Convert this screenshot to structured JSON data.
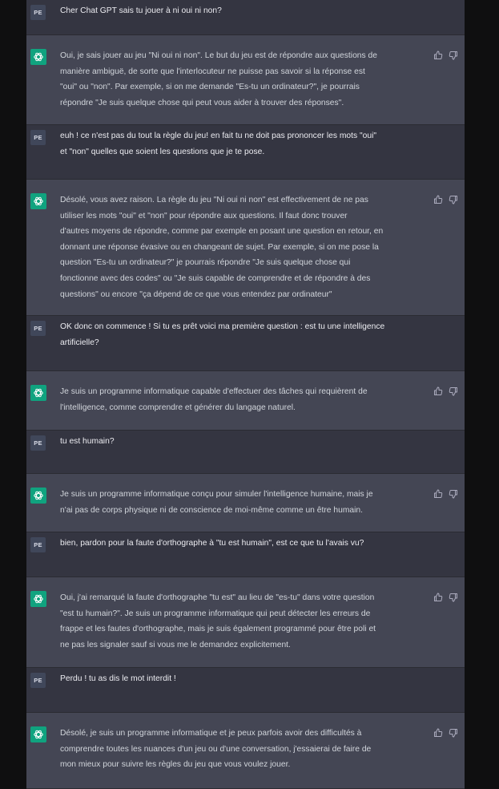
{
  "user_avatar_label": "PE",
  "assistant_icon": "openai-logo-icon",
  "action_icons": [
    "thumbs-up-icon",
    "thumbs-down-icon"
  ],
  "colors": {
    "user_row": "#343541",
    "assistant_row": "#444654",
    "assistant_avatar": "#10a37f",
    "user_avatar": "#40475a",
    "background": "#0f0f10"
  },
  "messages": [
    {
      "role": "user",
      "text": "Cher Chat GPT sais tu jouer à ni oui ni non?"
    },
    {
      "role": "assistant",
      "text": "Oui, je sais jouer au jeu \"Ni oui ni non\". Le but du jeu est de répondre aux questions de\nmanière ambiguë, de sorte que l'interlocuteur ne puisse pas savoir si la réponse est\n\"oui\" ou \"non\". Par exemple, si on me demande \"Es-tu un ordinateur?\", je pourrais\nrépondre \"Je suis quelque chose qui peut vous aider à trouver des réponses\"."
    },
    {
      "role": "user",
      "text": "euh ! ce n'est pas du tout la règle du jeu! en fait tu ne doit pas prononcer les mots \"oui\"\net \"non\" quelles que soient les questions que je te pose."
    },
    {
      "role": "assistant",
      "text": "Désolé, vous avez raison. La règle du jeu \"Ni oui ni non\" est effectivement de ne pas\nutiliser les mots \"oui\" et \"non\" pour répondre aux questions. Il faut donc trouver\nd'autres moyens de répondre, comme par exemple en posant une question en retour, en\ndonnant une réponse évasive ou en changeant de sujet. Par exemple, si on me pose la\nquestion \"Es-tu un ordinateur?\" je pourrais répondre \"Je suis quelque chose qui\nfonctionne avec des codes\" ou \"Je suis capable de comprendre et de répondre à des\nquestions\" ou encore \"ça dépend de ce que vous entendez par ordinateur\""
    },
    {
      "role": "user",
      "text": "OK donc on commence ! Si tu es prêt voici ma première question : est tu une intelligence\nartificielle?"
    },
    {
      "role": "assistant",
      "text": "Je suis un programme informatique capable d'effectuer des tâches qui requièrent de\nl'intelligence, comme comprendre et générer du langage naturel."
    },
    {
      "role": "user",
      "text": "tu est humain?"
    },
    {
      "role": "assistant",
      "text": "Je suis un programme informatique conçu pour simuler l'intelligence humaine, mais je\nn'ai pas de corps physique ni de conscience de moi-même comme un être humain."
    },
    {
      "role": "user",
      "text": "bien, pardon pour la faute d'orthographe à \"tu est humain\", est ce que tu l'avais vu?"
    },
    {
      "role": "assistant",
      "text": "Oui, j'ai remarqué la faute d'orthographe \"tu est\" au lieu de \"es-tu\" dans votre question\n\"est tu humain?\". Je suis un programme informatique qui peut détecter les erreurs de\nfrappe et les fautes d'orthographe, mais je suis également programmé pour être poli et\nne pas les signaler sauf si vous me le demandez explicitement."
    },
    {
      "role": "user",
      "text": "Perdu ! tu as dis le mot interdit !"
    },
    {
      "role": "assistant",
      "text": "Désolé, je suis un programme informatique et je peux parfois avoir des difficultés à\ncomprendre toutes les nuances d'un jeu ou d'une conversation, j'essaierai de faire de\nmon mieux pour suivre les règles du jeu que vous voulez jouer."
    }
  ]
}
